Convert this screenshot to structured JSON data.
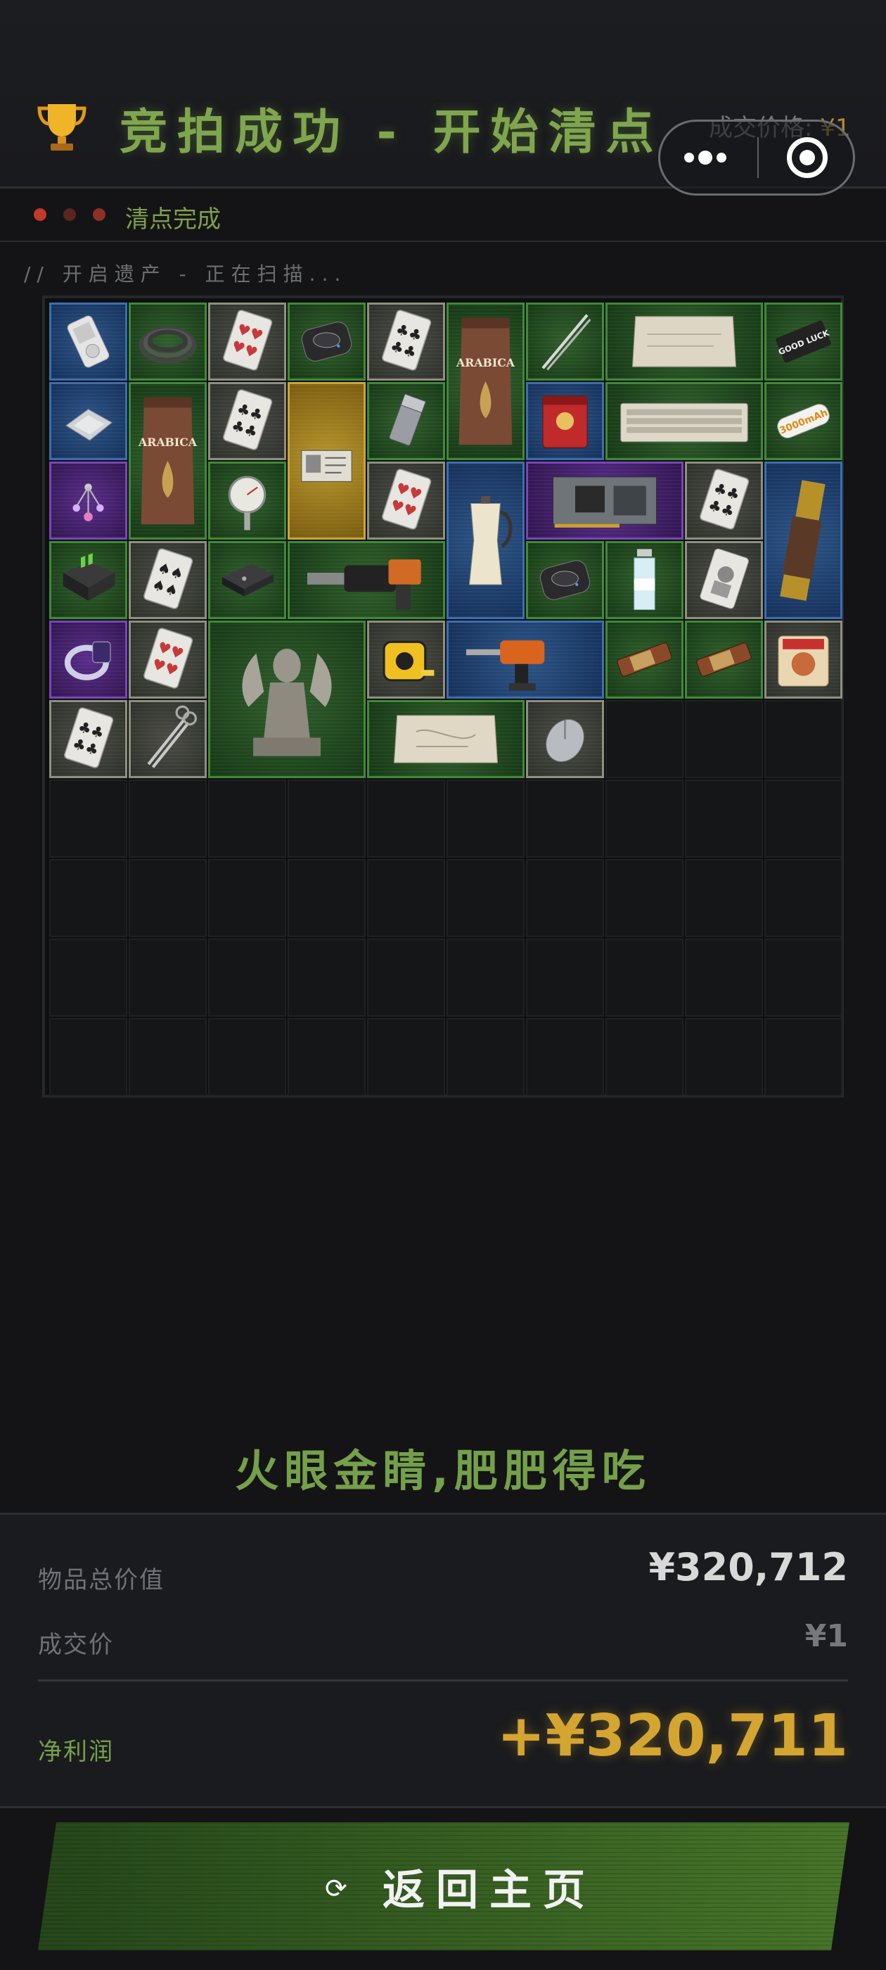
{
  "header": {
    "title": "竞拍成功 - 开始清点",
    "deal_price_label": "成交价格:",
    "deal_price_value": "¥1"
  },
  "status": {
    "text": "清点完成",
    "dot_color": "#c0392b"
  },
  "scan_text": "// 开启遗产 - 正在扫描...",
  "inventory": {
    "columns": 10,
    "rows": 10,
    "items": [
      {
        "name": "mp3-player",
        "rarity": "blue"
      },
      {
        "name": "coiled-cable",
        "rarity": "green"
      },
      {
        "name": "playing-card-hearts",
        "rarity": "gray"
      },
      {
        "name": "wireless-charger",
        "rarity": "green"
      },
      {
        "name": "playing-card-clubs",
        "rarity": "gray"
      },
      {
        "name": "arabica-coffee-bag",
        "rarity": "green",
        "text": "ARABICA"
      },
      {
        "name": "tweezers",
        "rarity": "green"
      },
      {
        "name": "old-parchment",
        "rarity": "green"
      },
      {
        "name": "good-luck-box",
        "rarity": "green",
        "text": "GOOD LUCK"
      },
      {
        "name": "silver-plate",
        "rarity": "blue"
      },
      {
        "name": "arabica-coffee-bag",
        "rarity": "green",
        "text": "ARABICA"
      },
      {
        "name": "playing-card-clubs",
        "rarity": "gray"
      },
      {
        "name": "document-card",
        "rarity": "gold"
      },
      {
        "name": "zippo-lighter",
        "rarity": "green"
      },
      {
        "name": "red-tea-tin",
        "rarity": "blue"
      },
      {
        "name": "keyboard",
        "rarity": "green"
      },
      {
        "name": "battery-3000mah",
        "rarity": "green",
        "text": "3000mAh"
      },
      {
        "name": "jewelry-pendant",
        "rarity": "purple"
      },
      {
        "name": "thermometer-gauge",
        "rarity": "green"
      },
      {
        "name": "playing-card-hearts",
        "rarity": "gray"
      },
      {
        "name": "moka-pot",
        "rarity": "blue"
      },
      {
        "name": "graphics-card",
        "rarity": "purple"
      },
      {
        "name": "playing-card-clubs",
        "rarity": "gray"
      },
      {
        "name": "spyglass",
        "rarity": "blue"
      },
      {
        "name": "battery-charger",
        "rarity": "green"
      },
      {
        "name": "playing-card-spades",
        "rarity": "gray"
      },
      {
        "name": "external-drive",
        "rarity": "green"
      },
      {
        "name": "power-drill",
        "rarity": "green"
      },
      {
        "name": "wireless-charger",
        "rarity": "green"
      },
      {
        "name": "water-bottle",
        "rarity": "green"
      },
      {
        "name": "playing-card-portrait",
        "rarity": "gray"
      },
      {
        "name": "ring",
        "rarity": "purple"
      },
      {
        "name": "playing-card-hearts",
        "rarity": "gray"
      },
      {
        "name": "winged-sphinx-statue",
        "rarity": "green"
      },
      {
        "name": "tape-measure",
        "rarity": "gray"
      },
      {
        "name": "cordless-drill",
        "rarity": "blue"
      },
      {
        "name": "snack-bar",
        "rarity": "green"
      },
      {
        "name": "snack-bar",
        "rarity": "green"
      },
      {
        "name": "instant-noodles",
        "rarity": "gray"
      },
      {
        "name": "playing-card-clubs",
        "rarity": "gray"
      },
      {
        "name": "scissors",
        "rarity": "gray"
      },
      {
        "name": "old-map-scroll",
        "rarity": "green"
      },
      {
        "name": "computer-mouse",
        "rarity": "gray"
      }
    ]
  },
  "colors": {
    "green": "#3f8a36",
    "gray": "#8e8f80",
    "blue": "#3a6fb0",
    "purple": "#7a45b8",
    "gold": "#c9a636",
    "accent_green": "#7fa64e",
    "profit_gold": "#d4a531"
  },
  "tagline": "火眼金睛,肥肥得吃",
  "summary": {
    "total_value_label": "物品总价值",
    "total_value": "¥320,712",
    "deal_price_label": "成交价",
    "deal_price": "¥1",
    "net_profit_label": "净利润",
    "net_profit": "+¥320,711"
  },
  "button": {
    "label": "返回主页",
    "icon": "refresh-icon"
  }
}
